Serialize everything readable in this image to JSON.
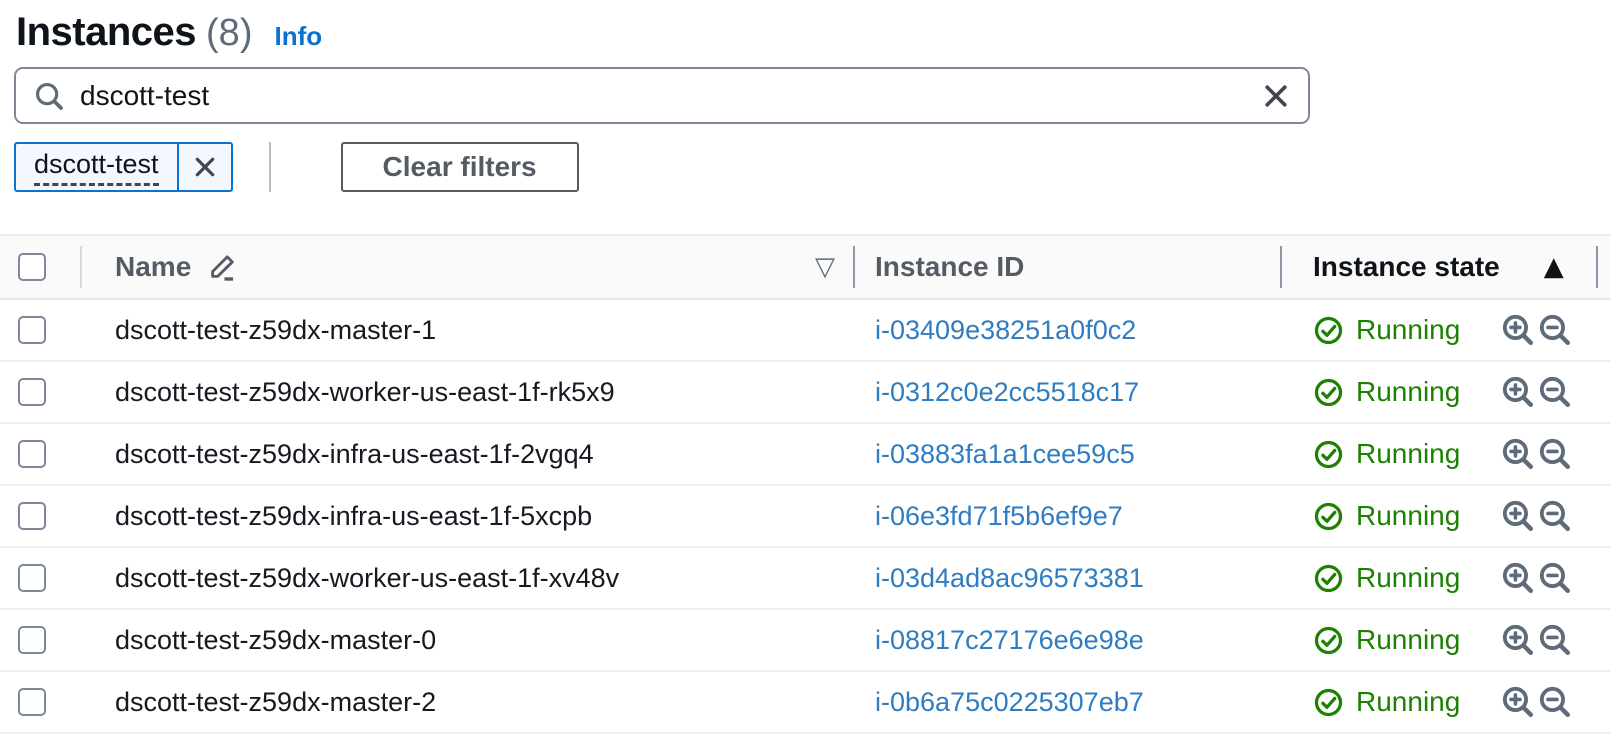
{
  "page": {
    "title": "Instances",
    "count": "(8)",
    "info_label": "Info"
  },
  "search": {
    "value": "dscott-test"
  },
  "filter": {
    "token_label": "dscott-test",
    "clear_filters_label": "Clear filters"
  },
  "table": {
    "columns": {
      "name": "Name",
      "instance_id": "Instance ID",
      "instance_state": "Instance state"
    },
    "sort": {
      "name_indicator": "▽",
      "state_indicator": "▲"
    },
    "rows": [
      {
        "name": "dscott-test-z59dx-master-1",
        "instance_id": "i-03409e38251a0f0c2",
        "state": "Running"
      },
      {
        "name": "dscott-test-z59dx-worker-us-east-1f-rk5x9",
        "instance_id": "i-0312c0e2cc5518c17",
        "state": "Running"
      },
      {
        "name": "dscott-test-z59dx-infra-us-east-1f-2vgq4",
        "instance_id": "i-03883fa1a1cee59c5",
        "state": "Running"
      },
      {
        "name": "dscott-test-z59dx-infra-us-east-1f-5xcpb",
        "instance_id": "i-06e3fd71f5b6ef9e7",
        "state": "Running"
      },
      {
        "name": "dscott-test-z59dx-worker-us-east-1f-xv48v",
        "instance_id": "i-03d4ad8ac96573381",
        "state": "Running"
      },
      {
        "name": "dscott-test-z59dx-master-0",
        "instance_id": "i-08817c27176e6e98e",
        "state": "Running"
      },
      {
        "name": "dscott-test-z59dx-master-2",
        "instance_id": "i-0b6a75c0225307eb7",
        "state": "Running"
      }
    ]
  },
  "colors": {
    "accent_blue": "#0972d3",
    "link_blue": "#2f7dc0",
    "success_green": "#1d8102",
    "header_gray": "#545b64",
    "text": "#0f141a"
  }
}
